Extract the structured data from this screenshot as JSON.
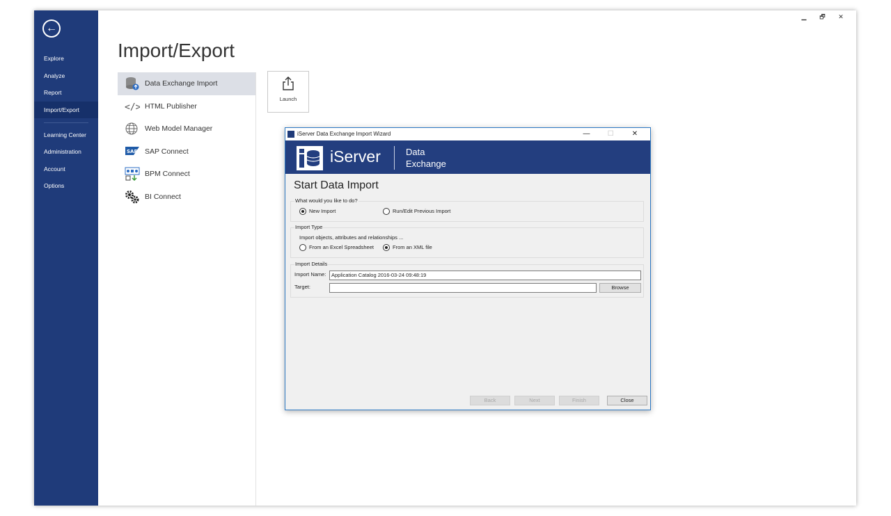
{
  "window_controls": {
    "minimize": "▁",
    "restore": "🗗",
    "close": "✕"
  },
  "nav": {
    "items": [
      "Explore",
      "Analyze",
      "Report",
      "Import/Export",
      "Learning Center",
      "Administration",
      "Account",
      "Options"
    ],
    "active": "Import/Export"
  },
  "page_title": "Import/Export",
  "sublist": {
    "items": [
      "Data Exchange Import",
      "HTML Publisher",
      "Web Model Manager",
      "SAP Connect",
      "BPM Connect",
      "BI Connect"
    ],
    "selected": "Data Exchange Import"
  },
  "launch_button": {
    "label": "Launch",
    "icon": "share-export-icon"
  },
  "dialog": {
    "title": "iServer Data Exchange Import Wizard",
    "controls": {
      "minimize": "—",
      "maximize": "☐",
      "close": "✕"
    },
    "banner": {
      "logo_text": "iServer",
      "sub_line1": "Data",
      "sub_line2": "Exchange"
    },
    "heading": "Start Data Import",
    "action_group": {
      "label": "What would you like to do?",
      "options": [
        "New Import",
        "Run/Edit Previous Import"
      ],
      "selected": "New Import"
    },
    "type_group": {
      "label": "Import Type",
      "hint": "Import objects, attributes and relationships ...",
      "options": [
        "From an Excel Spreadsheet",
        "From an XML file"
      ],
      "selected": "From an XML file"
    },
    "details_group": {
      "label": "Import Details",
      "name_label": "Import Name:",
      "name_value": "Application Catalog 2016-03-24 09:48:19",
      "target_label": "Target:",
      "target_value": "",
      "browse_label": "Browse"
    },
    "footer": {
      "back": "Back",
      "next": "Next",
      "finish": "Finish",
      "close": "Close"
    }
  },
  "colors": {
    "nav_bg": "#1f3b7a",
    "banner_bg": "#233e7f",
    "selected_item": "#dcdfe6"
  }
}
